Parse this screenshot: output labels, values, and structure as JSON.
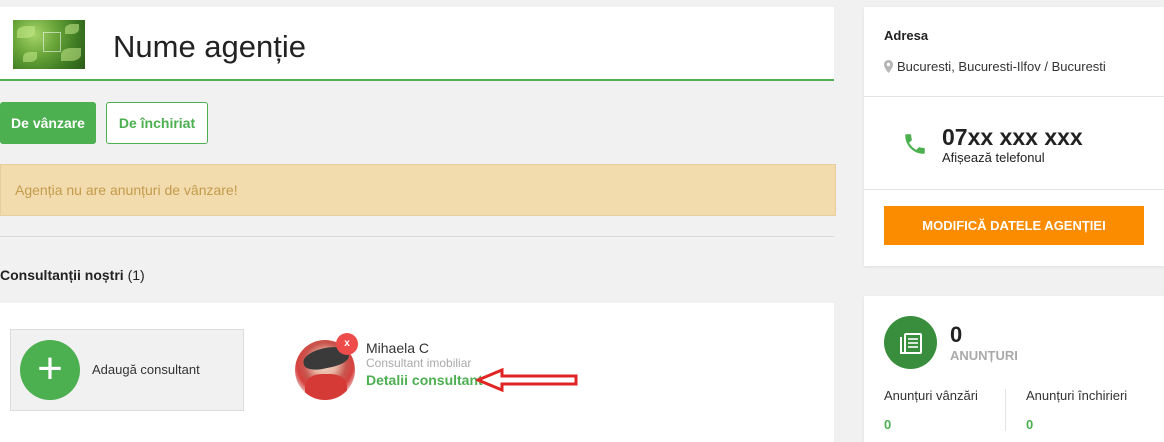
{
  "header": {
    "agency_name": "Nume agenție"
  },
  "tabs": {
    "sale": "De vânzare",
    "rent": "De închiriat"
  },
  "alert": {
    "message": "Agenția nu are anunțuri de vânzare!"
  },
  "consultants": {
    "title": "Consultanții noștri",
    "count": "(1)",
    "add_label": "Adaugă consultant",
    "add_symbol": "+",
    "items": [
      {
        "name": "Mihaela C",
        "role": "Consultant imobiliar",
        "details_link": "Detalii consultant",
        "remove_label": "x"
      }
    ]
  },
  "info": {
    "address_title": "Adresa",
    "address": "Bucuresti, Bucuresti-Ilfov / Bucuresti",
    "phone": "07xx xxx xxx",
    "phone_reveal": "Afișează telefonul",
    "edit_button": "MODIFICĂ DATELE AGENȚIEI"
  },
  "stats": {
    "total": "0",
    "label": "ANUNȚURI",
    "sale_label": "Anunțuri vânzări",
    "sale_count": "0",
    "rent_label": "Anunțuri închirieri",
    "rent_count": "0"
  },
  "colors": {
    "accent_green": "#4caf50",
    "orange": "#fb8c00",
    "alert_bg": "#f2dcae",
    "remove_red": "#ee4b4b",
    "arrow_red": "#e02424"
  },
  "icons": [
    "agency-logo",
    "plus-icon",
    "close-icon",
    "arrow-left-icon",
    "location-pin-icon",
    "phone-icon",
    "listings-icon"
  ]
}
